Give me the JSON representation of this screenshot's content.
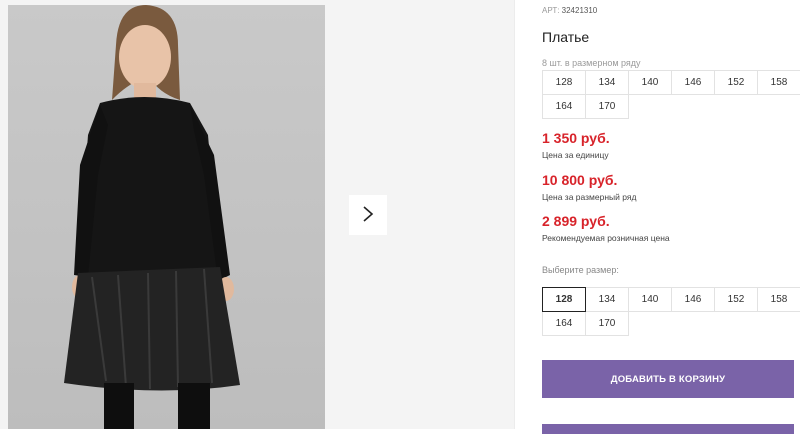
{
  "product": {
    "sku_label": "АРТ:",
    "sku_value": "32421310",
    "title": "Платье",
    "series_note": "8 шт. в размерном ряду",
    "series_sizes": [
      "128",
      "134",
      "140",
      "146",
      "152",
      "158",
      "164",
      "170"
    ]
  },
  "prices": [
    {
      "amount": "1 350 руб.",
      "label": "Цена за единицу"
    },
    {
      "amount": "10 800 руб.",
      "label": "Цена за размерный ряд"
    },
    {
      "amount": "2 899 руб.",
      "label": "Рекомендуемая розничная цена"
    }
  ],
  "size_select": {
    "label": "Выберите размер:",
    "selected": "128",
    "options": [
      "128",
      "134",
      "140",
      "146",
      "152",
      "158",
      "164",
      "170"
    ]
  },
  "actions": {
    "add_to_cart": "ДОБАВИТЬ В КОРЗИНУ"
  },
  "gallery": {
    "next_icon": "chevron-right-icon"
  },
  "colors": {
    "price": "#d8232a",
    "button": "#7a63a8"
  }
}
